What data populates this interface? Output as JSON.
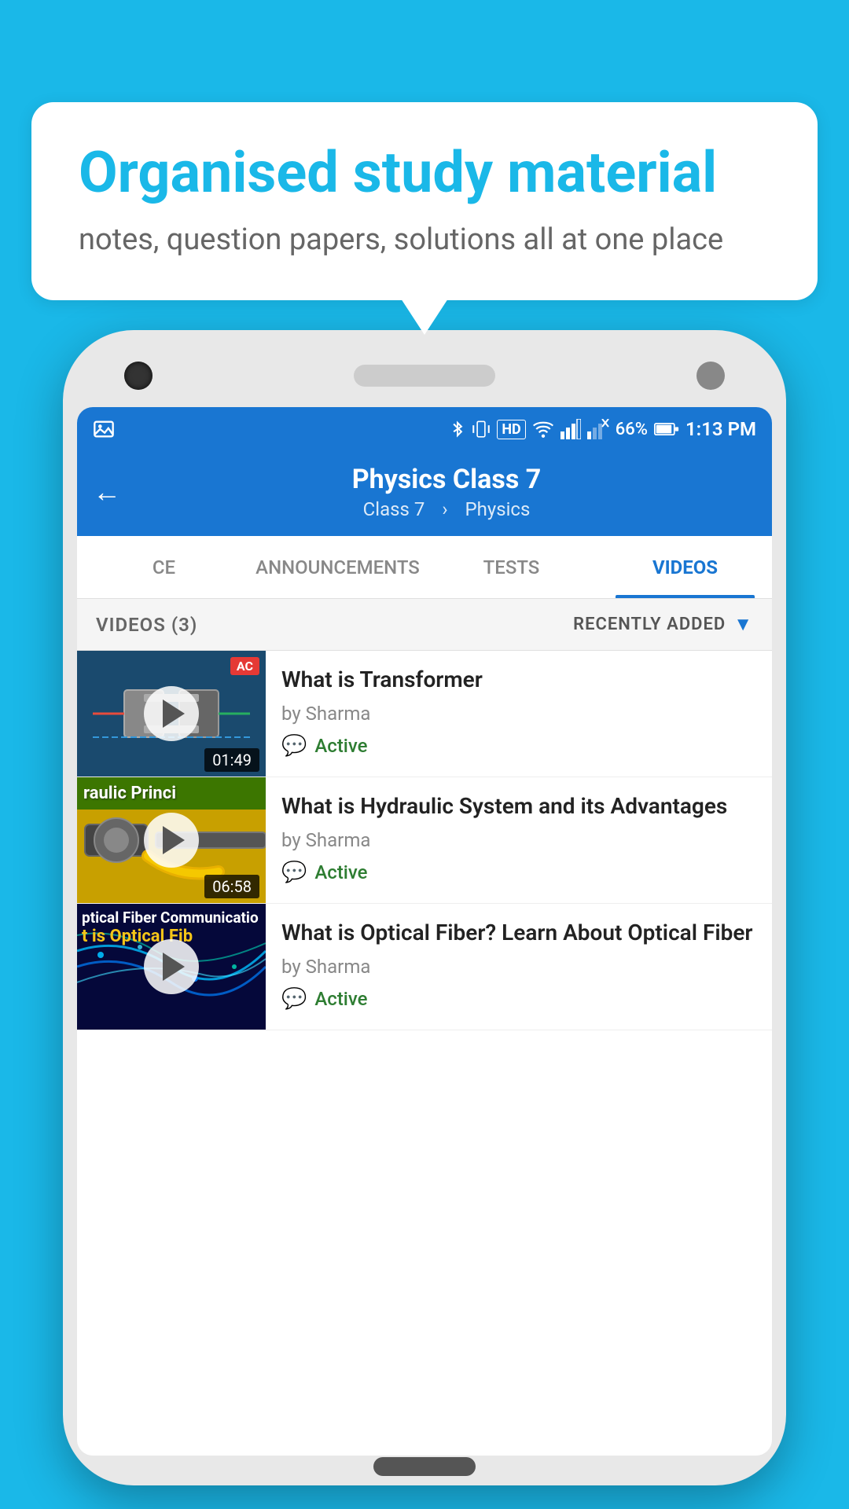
{
  "background_color": "#1ab8e8",
  "speech_bubble": {
    "heading": "Organised study material",
    "subtext": "notes, question papers, solutions all at one place"
  },
  "status_bar": {
    "battery": "66%",
    "time": "1:13 PM",
    "signal": "HD"
  },
  "app_header": {
    "back_label": "←",
    "title": "Physics Class 7",
    "breadcrumb_class": "Class 7",
    "breadcrumb_subject": "Physics"
  },
  "tabs": [
    {
      "id": "ce",
      "label": "CE",
      "active": false
    },
    {
      "id": "announcements",
      "label": "ANNOUNCEMENTS",
      "active": false
    },
    {
      "id": "tests",
      "label": "TESTS",
      "active": false
    },
    {
      "id": "videos",
      "label": "VIDEOS",
      "active": true
    }
  ],
  "videos_header": {
    "count_label": "VIDEOS (3)",
    "sort_label": "RECENTLY ADDED"
  },
  "videos": [
    {
      "id": "transformer",
      "title": "What is  Transformer",
      "author": "by Sharma",
      "status": "Active",
      "duration": "01:49",
      "thumbnail_type": "transformer",
      "badge": "AC"
    },
    {
      "id": "hydraulic",
      "title": "What is Hydraulic System and its Advantages",
      "author": "by Sharma",
      "status": "Active",
      "duration": "06:58",
      "thumbnail_type": "hydraulic",
      "overlay_text": "raulic Princi"
    },
    {
      "id": "optical",
      "title": "What is Optical Fiber? Learn About Optical Fiber",
      "author": "by Sharma",
      "status": "Active",
      "duration": "",
      "thumbnail_type": "optical",
      "overlay_line1": "ptical Fiber Communicatio",
      "overlay_line2": "t is Optical Fib"
    }
  ]
}
